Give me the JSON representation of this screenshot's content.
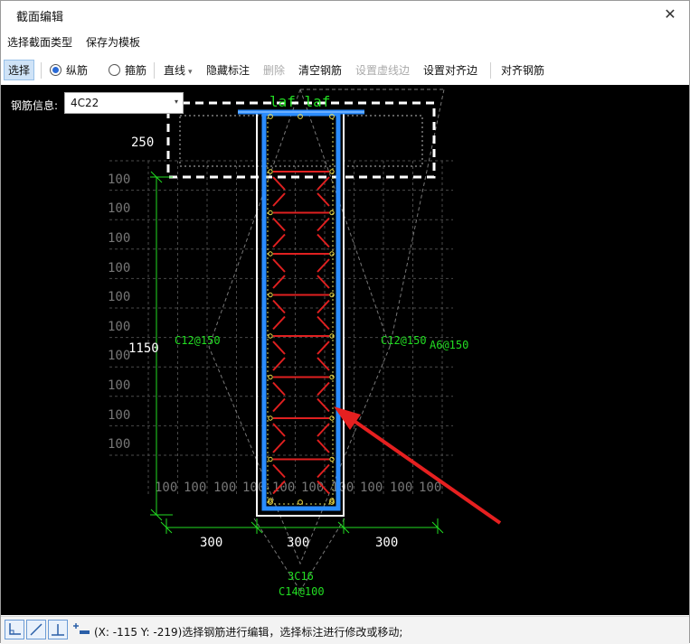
{
  "window": {
    "title": "截面编辑",
    "close_glyph": "✕"
  },
  "menu": {
    "items": [
      {
        "label": "选择截面类型"
      },
      {
        "label": "保存为模板"
      }
    ]
  },
  "toolbar": {
    "select": "选择",
    "longitudinal": "纵筋",
    "stirrup": "箍筋",
    "line": "直线",
    "line_caret": "▾",
    "hide_annotation": "隐藏标注",
    "delete": "删除",
    "clear_rebar": "清空钢筋",
    "set_dashed_edge": "设置虚线边",
    "set_align_edge": "设置对齐边",
    "align_rebar": "对齐钢筋"
  },
  "rebar_info": {
    "label": "钢筋信息:",
    "value": "4C22",
    "caret": "▾"
  },
  "drawing": {
    "top_label": "laf laf",
    "flange_dim": "250",
    "height_dim": "1150",
    "grid_label": "100",
    "side_rebar_left": "C12@150",
    "side_rebar_right": "C12@150",
    "tie_rebar": "A6@150",
    "width_dims": [
      "300",
      "300",
      "300"
    ],
    "bottom_rebar": "3C16",
    "stirrup_rebar": "C14@100",
    "colors": {
      "dim": "#22dd22",
      "rebar_blue": "#2a8cff",
      "tie_red": "#e02020",
      "grid": "#555555",
      "arrow": "#e62020"
    }
  },
  "status": {
    "text": "(X: -115 Y: -219)选择钢筋进行编辑，选择标注进行修改或移动;"
  }
}
